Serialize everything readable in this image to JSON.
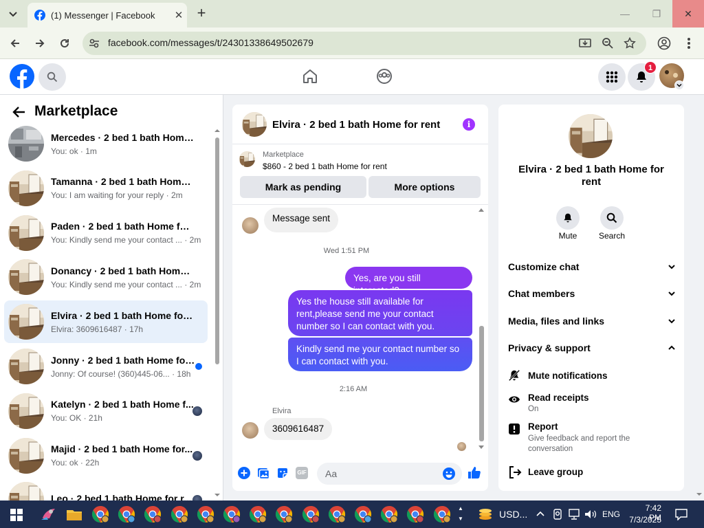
{
  "browser": {
    "tab_title": "(1) Messenger | Facebook",
    "url": "facebook.com/messages/t/24301338649502679"
  },
  "fb_header": {
    "notification_count": "1"
  },
  "sidebar": {
    "back_title": "Marketplace",
    "conversations": [
      {
        "name": "Mercedes · 2 bed 1 bath Home f...",
        "preview": "You: ok · 1m",
        "unread": false
      },
      {
        "name": "Tamanna · 2 bed 1 bath Home f...",
        "preview": "You: I am waiting for your reply · 2m",
        "unread": false
      },
      {
        "name": "Paden · 2 bed 1 bath Home for r...",
        "preview": "You: Kindly send me your contact ... · 2m",
        "unread": false
      },
      {
        "name": "Donancy · 2 bed 1 bath Home fo...",
        "preview": "You: Kindly send me your contact ... · 2m",
        "unread": false
      },
      {
        "name": "Elvira · 2 bed 1 bath Home for re...",
        "preview": "Elvira: 3609616487 · 17h",
        "unread": false,
        "active": true
      },
      {
        "name": "Jonny · 2 bed 1 bath Home for...",
        "preview": "Jonny: Of course! (360)445-06... · 18h",
        "unread": true
      },
      {
        "name": "Katelyn · 2 bed 1 bath Home f...",
        "preview": "You: OK · 21h",
        "unread": false
      },
      {
        "name": "Majid · 2 bed 1 bath Home for...",
        "preview": "You: ok · 22h",
        "unread": false
      },
      {
        "name": "Leo · 2 bed 1 bath Home for r...",
        "preview": "",
        "unread": false
      }
    ]
  },
  "chat": {
    "title": "Elvira · 2 bed 1 bath Home for rent",
    "listing_source": "Marketplace",
    "listing_summary": "$860 - 2 bed 1 bath Home for rent",
    "mark_pending_label": "Mark as pending",
    "more_options_label": "More options",
    "messages": [
      {
        "from": "them",
        "text": "Message sent"
      },
      {
        "type": "time",
        "text": "Wed 1:51 PM"
      },
      {
        "from": "me",
        "text": "Yes, are you still interested?"
      },
      {
        "from": "me",
        "text": "Yes the house still available for rent,please send me your contact number so I can contact with you."
      },
      {
        "from": "me",
        "text": "Kindly  send me your contact number so I can contact with you."
      },
      {
        "type": "time",
        "text": "2:16 AM"
      },
      {
        "sender_label": "Elvira"
      },
      {
        "from": "them",
        "text": "3609616487"
      }
    ],
    "composer_placeholder": "Aa"
  },
  "info_panel": {
    "name": "Elvira · 2 bed 1 bath Home for rent",
    "mute_label": "Mute",
    "search_label": "Search",
    "sections": [
      "Customize chat",
      "Chat members",
      "Media, files and links",
      "Privacy & support"
    ],
    "privacy_items": [
      {
        "label": "Mute notifications",
        "sub": ""
      },
      {
        "label": "Read receipts",
        "sub": "On"
      },
      {
        "label": "Report",
        "sub": "Give feedback and report the conversation"
      },
      {
        "label": "Leave group",
        "sub": ""
      }
    ]
  },
  "taskbar": {
    "currency": "USD...",
    "language": "ENG",
    "time": "7:42 PM",
    "date": "7/3/2025"
  },
  "colors": {
    "accent": "#7b3ff2",
    "fb_blue": "#0866ff",
    "taskbar": "#1e2d4f"
  }
}
